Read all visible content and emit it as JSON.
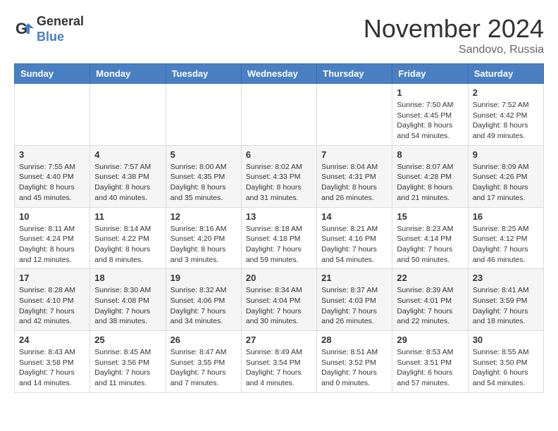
{
  "header": {
    "logo_general": "General",
    "logo_blue": "Blue",
    "month_title": "November 2024",
    "location": "Sandovo, Russia"
  },
  "calendar": {
    "days_of_week": [
      "Sunday",
      "Monday",
      "Tuesday",
      "Wednesday",
      "Thursday",
      "Friday",
      "Saturday"
    ],
    "weeks": [
      [
        {
          "day": "",
          "info": ""
        },
        {
          "day": "",
          "info": ""
        },
        {
          "day": "",
          "info": ""
        },
        {
          "day": "",
          "info": ""
        },
        {
          "day": "",
          "info": ""
        },
        {
          "day": "1",
          "info": "Sunrise: 7:50 AM\nSunset: 4:45 PM\nDaylight: 8 hours\nand 54 minutes."
        },
        {
          "day": "2",
          "info": "Sunrise: 7:52 AM\nSunset: 4:42 PM\nDaylight: 8 hours\nand 49 minutes."
        }
      ],
      [
        {
          "day": "3",
          "info": "Sunrise: 7:55 AM\nSunset: 4:40 PM\nDaylight: 8 hours\nand 45 minutes."
        },
        {
          "day": "4",
          "info": "Sunrise: 7:57 AM\nSunset: 4:38 PM\nDaylight: 8 hours\nand 40 minutes."
        },
        {
          "day": "5",
          "info": "Sunrise: 8:00 AM\nSunset: 4:35 PM\nDaylight: 8 hours\nand 35 minutes."
        },
        {
          "day": "6",
          "info": "Sunrise: 8:02 AM\nSunset: 4:33 PM\nDaylight: 8 hours\nand 31 minutes."
        },
        {
          "day": "7",
          "info": "Sunrise: 8:04 AM\nSunset: 4:31 PM\nDaylight: 8 hours\nand 26 minutes."
        },
        {
          "day": "8",
          "info": "Sunrise: 8:07 AM\nSunset: 4:28 PM\nDaylight: 8 hours\nand 21 minutes."
        },
        {
          "day": "9",
          "info": "Sunrise: 8:09 AM\nSunset: 4:26 PM\nDaylight: 8 hours\nand 17 minutes."
        }
      ],
      [
        {
          "day": "10",
          "info": "Sunrise: 8:11 AM\nSunset: 4:24 PM\nDaylight: 8 hours\nand 12 minutes."
        },
        {
          "day": "11",
          "info": "Sunrise: 8:14 AM\nSunset: 4:22 PM\nDaylight: 8 hours\nand 8 minutes."
        },
        {
          "day": "12",
          "info": "Sunrise: 8:16 AM\nSunset: 4:20 PM\nDaylight: 8 hours\nand 3 minutes."
        },
        {
          "day": "13",
          "info": "Sunrise: 8:18 AM\nSunset: 4:18 PM\nDaylight: 7 hours\nand 59 minutes."
        },
        {
          "day": "14",
          "info": "Sunrise: 8:21 AM\nSunset: 4:16 PM\nDaylight: 7 hours\nand 54 minutes."
        },
        {
          "day": "15",
          "info": "Sunrise: 8:23 AM\nSunset: 4:14 PM\nDaylight: 7 hours\nand 50 minutes."
        },
        {
          "day": "16",
          "info": "Sunrise: 8:25 AM\nSunset: 4:12 PM\nDaylight: 7 hours\nand 46 minutes."
        }
      ],
      [
        {
          "day": "17",
          "info": "Sunrise: 8:28 AM\nSunset: 4:10 PM\nDaylight: 7 hours\nand 42 minutes."
        },
        {
          "day": "18",
          "info": "Sunrise: 8:30 AM\nSunset: 4:08 PM\nDaylight: 7 hours\nand 38 minutes."
        },
        {
          "day": "19",
          "info": "Sunrise: 8:32 AM\nSunset: 4:06 PM\nDaylight: 7 hours\nand 34 minutes."
        },
        {
          "day": "20",
          "info": "Sunrise: 8:34 AM\nSunset: 4:04 PM\nDaylight: 7 hours\nand 30 minutes."
        },
        {
          "day": "21",
          "info": "Sunrise: 8:37 AM\nSunset: 4:03 PM\nDaylight: 7 hours\nand 26 minutes."
        },
        {
          "day": "22",
          "info": "Sunrise: 8:39 AM\nSunset: 4:01 PM\nDaylight: 7 hours\nand 22 minutes."
        },
        {
          "day": "23",
          "info": "Sunrise: 8:41 AM\nSunset: 3:59 PM\nDaylight: 7 hours\nand 18 minutes."
        }
      ],
      [
        {
          "day": "24",
          "info": "Sunrise: 8:43 AM\nSunset: 3:58 PM\nDaylight: 7 hours\nand 14 minutes."
        },
        {
          "day": "25",
          "info": "Sunrise: 8:45 AM\nSunset: 3:56 PM\nDaylight: 7 hours\nand 11 minutes."
        },
        {
          "day": "26",
          "info": "Sunrise: 8:47 AM\nSunset: 3:55 PM\nDaylight: 7 hours\nand 7 minutes."
        },
        {
          "day": "27",
          "info": "Sunrise: 8:49 AM\nSunset: 3:54 PM\nDaylight: 7 hours\nand 4 minutes."
        },
        {
          "day": "28",
          "info": "Sunrise: 8:51 AM\nSunset: 3:52 PM\nDaylight: 7 hours\nand 0 minutes."
        },
        {
          "day": "29",
          "info": "Sunrise: 8:53 AM\nSunset: 3:51 PM\nDaylight: 6 hours\nand 57 minutes."
        },
        {
          "day": "30",
          "info": "Sunrise: 8:55 AM\nSunset: 3:50 PM\nDaylight: 6 hours\nand 54 minutes."
        }
      ]
    ]
  }
}
